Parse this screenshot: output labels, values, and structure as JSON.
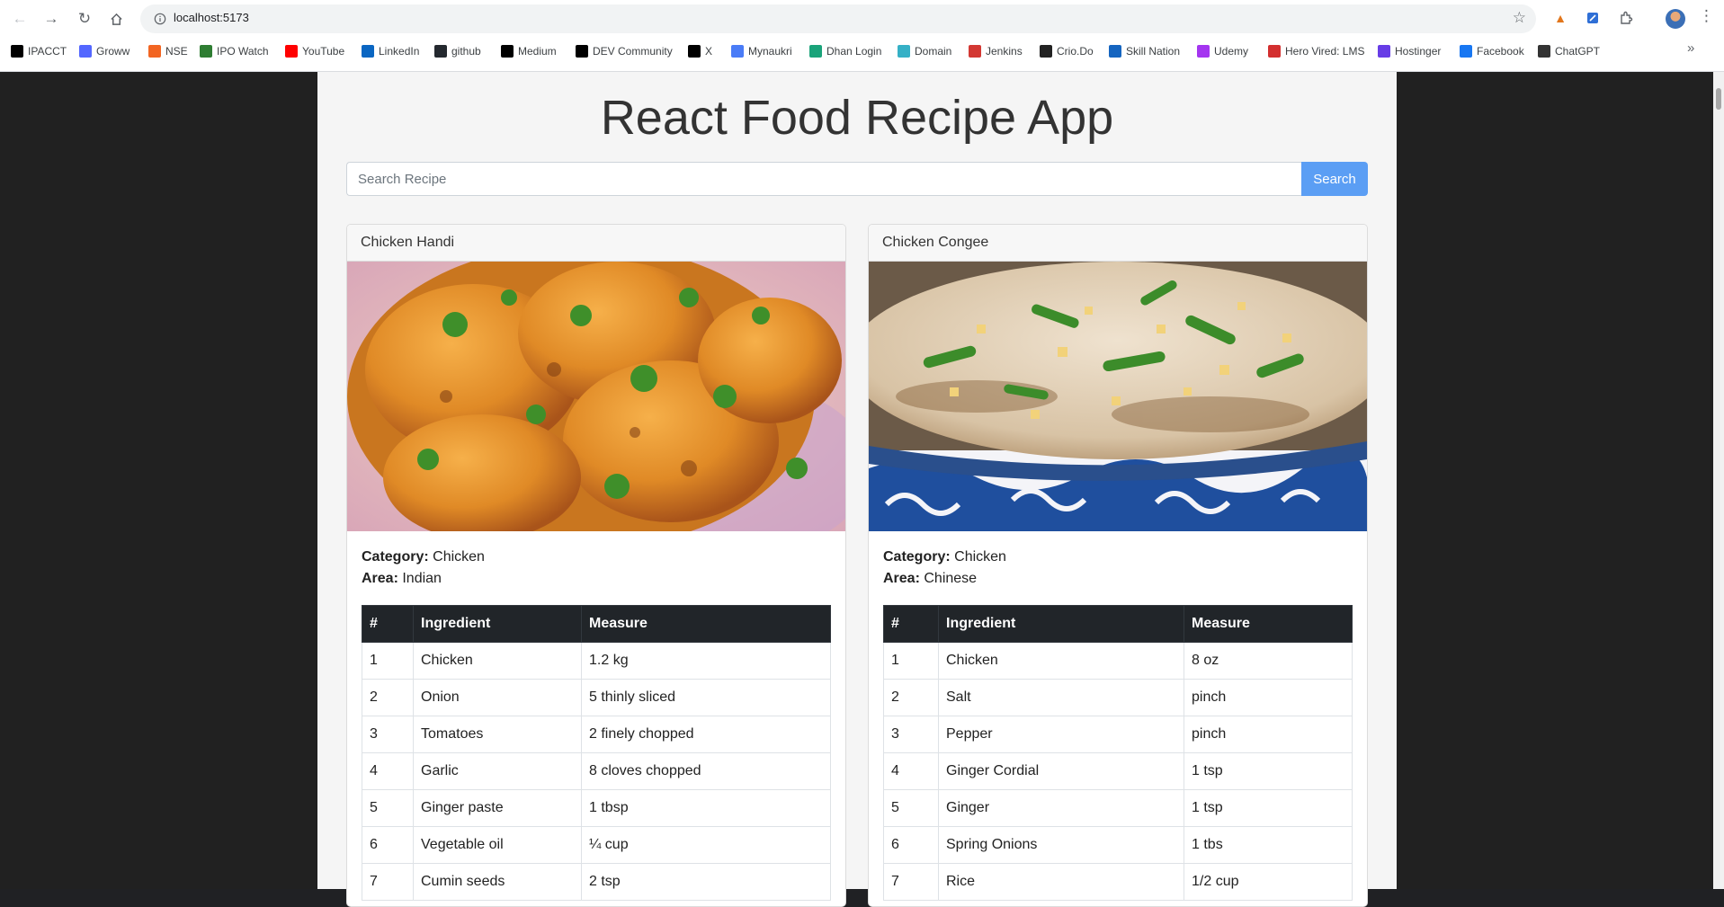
{
  "browser": {
    "url": "localhost:5173",
    "bookmarks": [
      {
        "label": "IPACCT",
        "icon": "ipacct-icon",
        "color": "#000000"
      },
      {
        "label": "Groww",
        "icon": "groww-icon",
        "color": "#5367ff"
      },
      {
        "label": "NSE",
        "icon": "nse-icon",
        "color": "#f26522"
      },
      {
        "label": "IPO Watch",
        "icon": "ipo-watch-icon",
        "color": "#2e7d32"
      },
      {
        "label": "YouTube",
        "icon": "youtube-icon",
        "color": "#ff0000"
      },
      {
        "label": "LinkedIn",
        "icon": "linkedin-icon",
        "color": "#0a66c2"
      },
      {
        "label": "github",
        "icon": "github-icon",
        "color": "#24292f"
      },
      {
        "label": "Medium",
        "icon": "medium-icon",
        "color": "#000000"
      },
      {
        "label": "DEV Community",
        "icon": "dev-icon",
        "color": "#000000"
      },
      {
        "label": "X",
        "icon": "x-icon",
        "color": "#000000"
      },
      {
        "label": "Mynaukri",
        "icon": "mynaukri-icon",
        "color": "#4a7cf7"
      },
      {
        "label": "Dhan Login",
        "icon": "dhan-icon",
        "color": "#1aa37a"
      },
      {
        "label": "Domain",
        "icon": "domain-icon",
        "color": "#35b0c6"
      },
      {
        "label": "Jenkins",
        "icon": "jenkins-icon",
        "color": "#d33833"
      },
      {
        "label": "Crio.Do",
        "icon": "crio-icon",
        "color": "#222222"
      },
      {
        "label": "Skill Nation",
        "icon": "skill-nation-icon",
        "color": "#1565c0"
      },
      {
        "label": "Udemy",
        "icon": "udemy-icon",
        "color": "#a435f0"
      },
      {
        "label": "Hero Vired: LMS",
        "icon": "hero-vired-icon",
        "color": "#d32f2f"
      },
      {
        "label": "Hostinger",
        "icon": "hostinger-icon",
        "color": "#673de6"
      },
      {
        "label": "Facebook",
        "icon": "facebook-icon",
        "color": "#1877f2"
      },
      {
        "label": "ChatGPT",
        "icon": "chatgpt-icon",
        "color": "#333333"
      }
    ]
  },
  "app": {
    "title": "React Food Recipe App",
    "search_placeholder": "Search Recipe",
    "search_button": "Search",
    "accent": "#5b9ef4"
  },
  "recipes": [
    {
      "name": "Chicken Handi",
      "category_label": "Category:",
      "category": "Chicken",
      "area_label": "Area:",
      "area": "Indian",
      "headers": [
        "#",
        "Ingredient",
        "Measure"
      ],
      "ingredients": [
        {
          "n": "1",
          "ingredient": "Chicken",
          "measure": "1.2 kg"
        },
        {
          "n": "2",
          "ingredient": "Onion",
          "measure": "5 thinly sliced"
        },
        {
          "n": "3",
          "ingredient": "Tomatoes",
          "measure": "2 finely chopped"
        },
        {
          "n": "4",
          "ingredient": "Garlic",
          "measure": "8 cloves chopped"
        },
        {
          "n": "5",
          "ingredient": "Ginger paste",
          "measure": "1 tbsp"
        },
        {
          "n": "6",
          "ingredient": "Vegetable oil",
          "measure": "¼ cup"
        },
        {
          "n": "7",
          "ingredient": "Cumin seeds",
          "measure": "2 tsp"
        }
      ]
    },
    {
      "name": "Chicken Congee",
      "category_label": "Category:",
      "category": "Chicken",
      "area_label": "Area:",
      "area": "Chinese",
      "headers": [
        "#",
        "Ingredient",
        "Measure"
      ],
      "ingredients": [
        {
          "n": "1",
          "ingredient": "Chicken",
          "measure": "8 oz"
        },
        {
          "n": "2",
          "ingredient": "Salt",
          "measure": "pinch"
        },
        {
          "n": "3",
          "ingredient": "Pepper",
          "measure": "pinch"
        },
        {
          "n": "4",
          "ingredient": "Ginger Cordial",
          "measure": "1 tsp"
        },
        {
          "n": "5",
          "ingredient": "Ginger",
          "measure": "1 tsp"
        },
        {
          "n": "6",
          "ingredient": "Spring Onions",
          "measure": "1 tbs"
        },
        {
          "n": "7",
          "ingredient": "Rice",
          "measure": "1/2 cup"
        }
      ]
    }
  ]
}
